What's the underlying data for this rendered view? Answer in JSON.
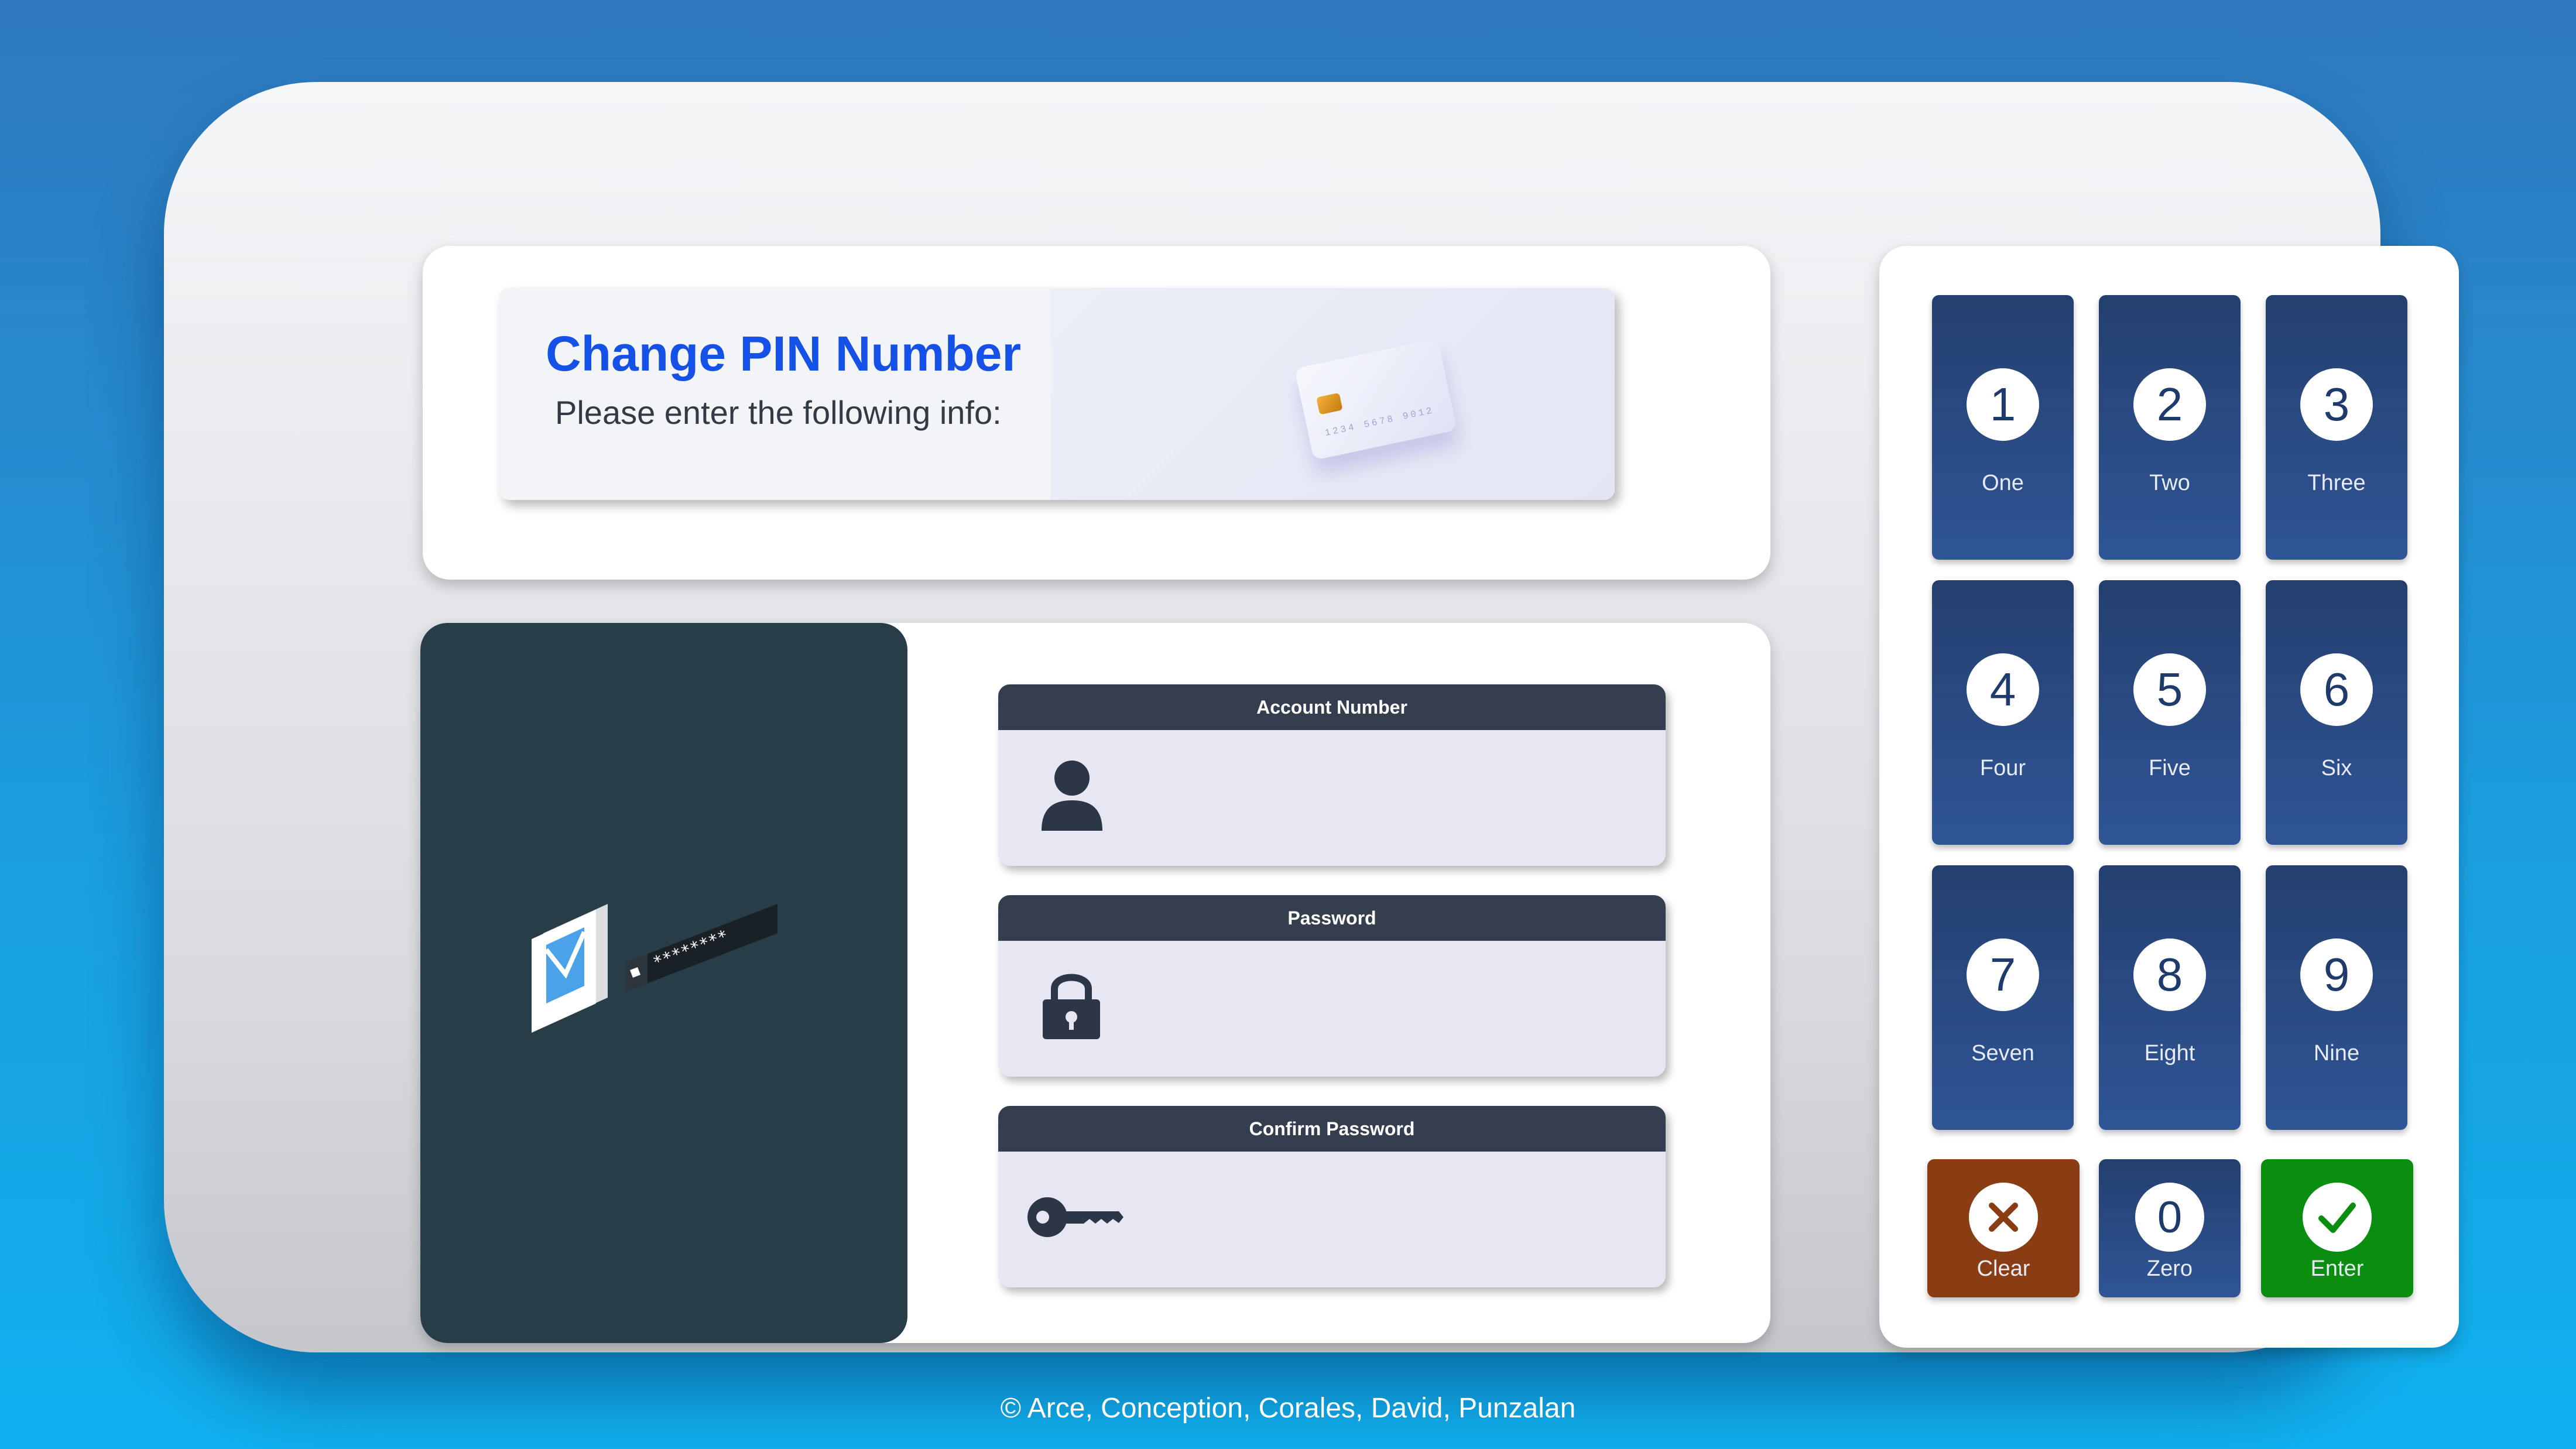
{
  "header": {
    "title": "Change PIN Number",
    "subtitle": "Please enter the following info:",
    "card_number": "1234 5678 9012"
  },
  "form": {
    "fields": [
      {
        "label": "Account Number",
        "icon": "user-icon"
      },
      {
        "label": "Password",
        "icon": "lock-icon"
      },
      {
        "label": "Confirm Password",
        "icon": "key-icon"
      }
    ],
    "illustration": {
      "masked_password": "********"
    }
  },
  "keypad": {
    "keys": [
      {
        "digit": "1",
        "label": "One"
      },
      {
        "digit": "2",
        "label": "Two"
      },
      {
        "digit": "3",
        "label": "Three"
      },
      {
        "digit": "4",
        "label": "Four"
      },
      {
        "digit": "5",
        "label": "Five"
      },
      {
        "digit": "6",
        "label": "Six"
      },
      {
        "digit": "7",
        "label": "Seven"
      },
      {
        "digit": "8",
        "label": "Eight"
      },
      {
        "digit": "9",
        "label": "Nine"
      }
    ],
    "clear": {
      "label": "Clear",
      "icon": "x-icon",
      "color": "#8a3d12"
    },
    "zero": {
      "digit": "0",
      "label": "Zero"
    },
    "enter": {
      "label": "Enter",
      "icon": "check-icon",
      "color": "#0b8d0f"
    }
  },
  "footer": {
    "credit": "© Arce, Conception, Corales, David, Punzalan"
  },
  "colors": {
    "accent": "#1551e6",
    "key_bg": "#2a4a85",
    "panel_dark": "#273d47"
  }
}
